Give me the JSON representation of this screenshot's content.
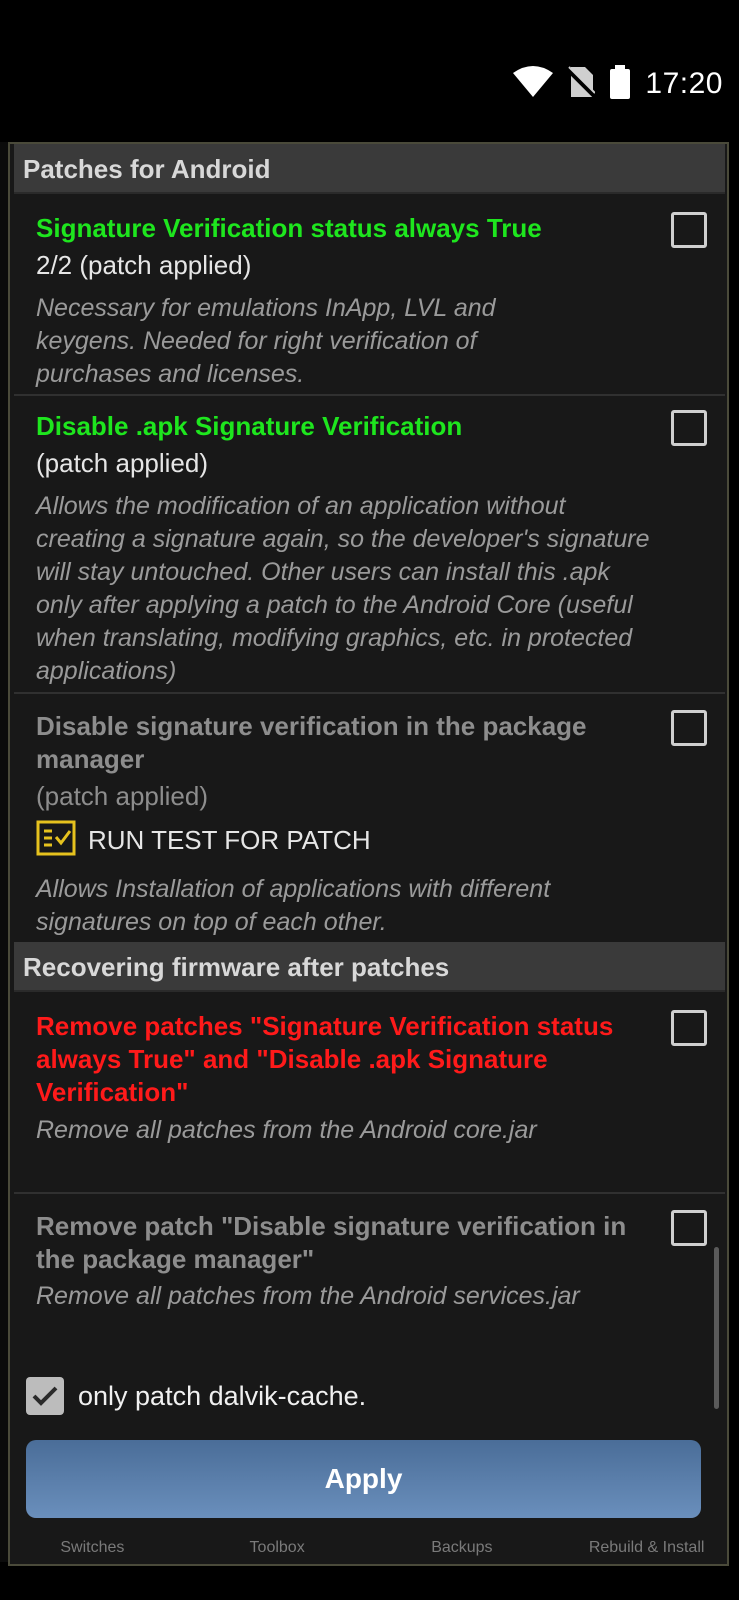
{
  "status_bar": {
    "time": "17:20",
    "icons": [
      "wifi-icon",
      "no-sim-icon",
      "battery-icon"
    ]
  },
  "sections": {
    "patches": {
      "header": "Patches for Android",
      "items": [
        {
          "title": "Signature Verification status always True",
          "status": "2/2 (patch applied)",
          "description": "Necessary for emulations InApp, LVL and keygens. Needed for right verification of purchases and licenses.",
          "checked": false
        },
        {
          "title": "Disable .apk Signature Verification",
          "status": "(patch applied)",
          "description": "Allows the modification of an application without creating a signature again, so the developer's signature will stay untouched. Other users can install this .apk only after applying a patch to the Android Core (useful when translating, modifying graphics, etc. in protected applications)",
          "checked": false
        },
        {
          "title": "Disable signature verification in the package manager",
          "status": "(patch applied)",
          "run_test_label": "RUN TEST FOR PATCH",
          "description": "Allows Installation of applications with different signatures on top of each other.",
          "checked": false
        }
      ]
    },
    "recovering": {
      "header": "Recovering firmware after patches",
      "items": [
        {
          "title": "Remove patches \"Signature Verification status always True\" and \"Disable .apk Signature Verification\"",
          "description": "Remove all patches from the Android core.jar",
          "checked": false
        },
        {
          "title": "Remove patch \"Disable signature verification in the package manager\"",
          "description": "Remove all patches from the Android services.jar",
          "checked": false
        }
      ]
    }
  },
  "only_dalvik": {
    "label": "only patch dalvik-cache.",
    "checked": true
  },
  "apply_button": {
    "label": "Apply"
  },
  "bottom_tabs": [
    "Switches",
    "Toolbox",
    "Backups",
    "Rebuild & Install"
  ],
  "colors": {
    "green": "#1ee61e",
    "red": "#ff1a1a",
    "apply_button": "#5a7eab"
  }
}
